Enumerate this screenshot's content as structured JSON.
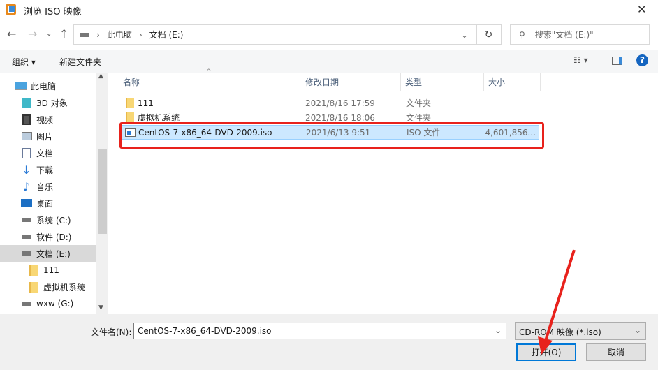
{
  "window": {
    "title": "浏览 ISO 映像",
    "close": "✕"
  },
  "nav": {
    "breadcrumb": [
      "此电脑",
      "文档 (E:)"
    ],
    "search_placeholder": "搜索\"文档 (E:)\""
  },
  "toolbar": {
    "organize": "组织",
    "new_folder": "新建文件夹"
  },
  "sidebar": {
    "items": [
      {
        "label": "此电脑",
        "icon": "computer-icon"
      },
      {
        "label": "3D 对象",
        "icon": "cube-icon"
      },
      {
        "label": "视频",
        "icon": "video-icon"
      },
      {
        "label": "图片",
        "icon": "picture-icon"
      },
      {
        "label": "文档",
        "icon": "document-icon"
      },
      {
        "label": "下载",
        "icon": "download-icon"
      },
      {
        "label": "音乐",
        "icon": "music-icon"
      },
      {
        "label": "桌面",
        "icon": "desktop-icon"
      },
      {
        "label": "系统 (C:)",
        "icon": "drive-icon"
      },
      {
        "label": "软件 (D:)",
        "icon": "drive-icon"
      },
      {
        "label": "文档 (E:)",
        "icon": "drive-icon",
        "selected": true
      },
      {
        "label": "111",
        "icon": "folder-icon"
      },
      {
        "label": "虚拟机系统",
        "icon": "folder-icon"
      },
      {
        "label": "wxw (G:)",
        "icon": "drive-icon"
      }
    ]
  },
  "columns": [
    "名称",
    "修改日期",
    "类型",
    "大小"
  ],
  "files": [
    {
      "name": "111",
      "date": "2021/8/16 17:59",
      "type": "文件夹",
      "size": ""
    },
    {
      "name": "虚拟机系统",
      "date": "2021/8/16 18:06",
      "type": "文件夹",
      "size": ""
    },
    {
      "name": "CentOS-7-x86_64-DVD-2009.iso",
      "date": "2021/6/13 9:51",
      "type": "ISO 文件",
      "size": "4,601,856..."
    }
  ],
  "footer": {
    "filename_label": "文件名(N):",
    "filename_value": "CentOS-7-x86_64-DVD-2009.iso",
    "filter": "CD-ROM 映像 (*.iso)",
    "open": "打开(O)",
    "cancel": "取消"
  },
  "colors": {
    "selection": "#cce8ff",
    "highlight": "#e8221c",
    "accent": "#0078d7"
  }
}
